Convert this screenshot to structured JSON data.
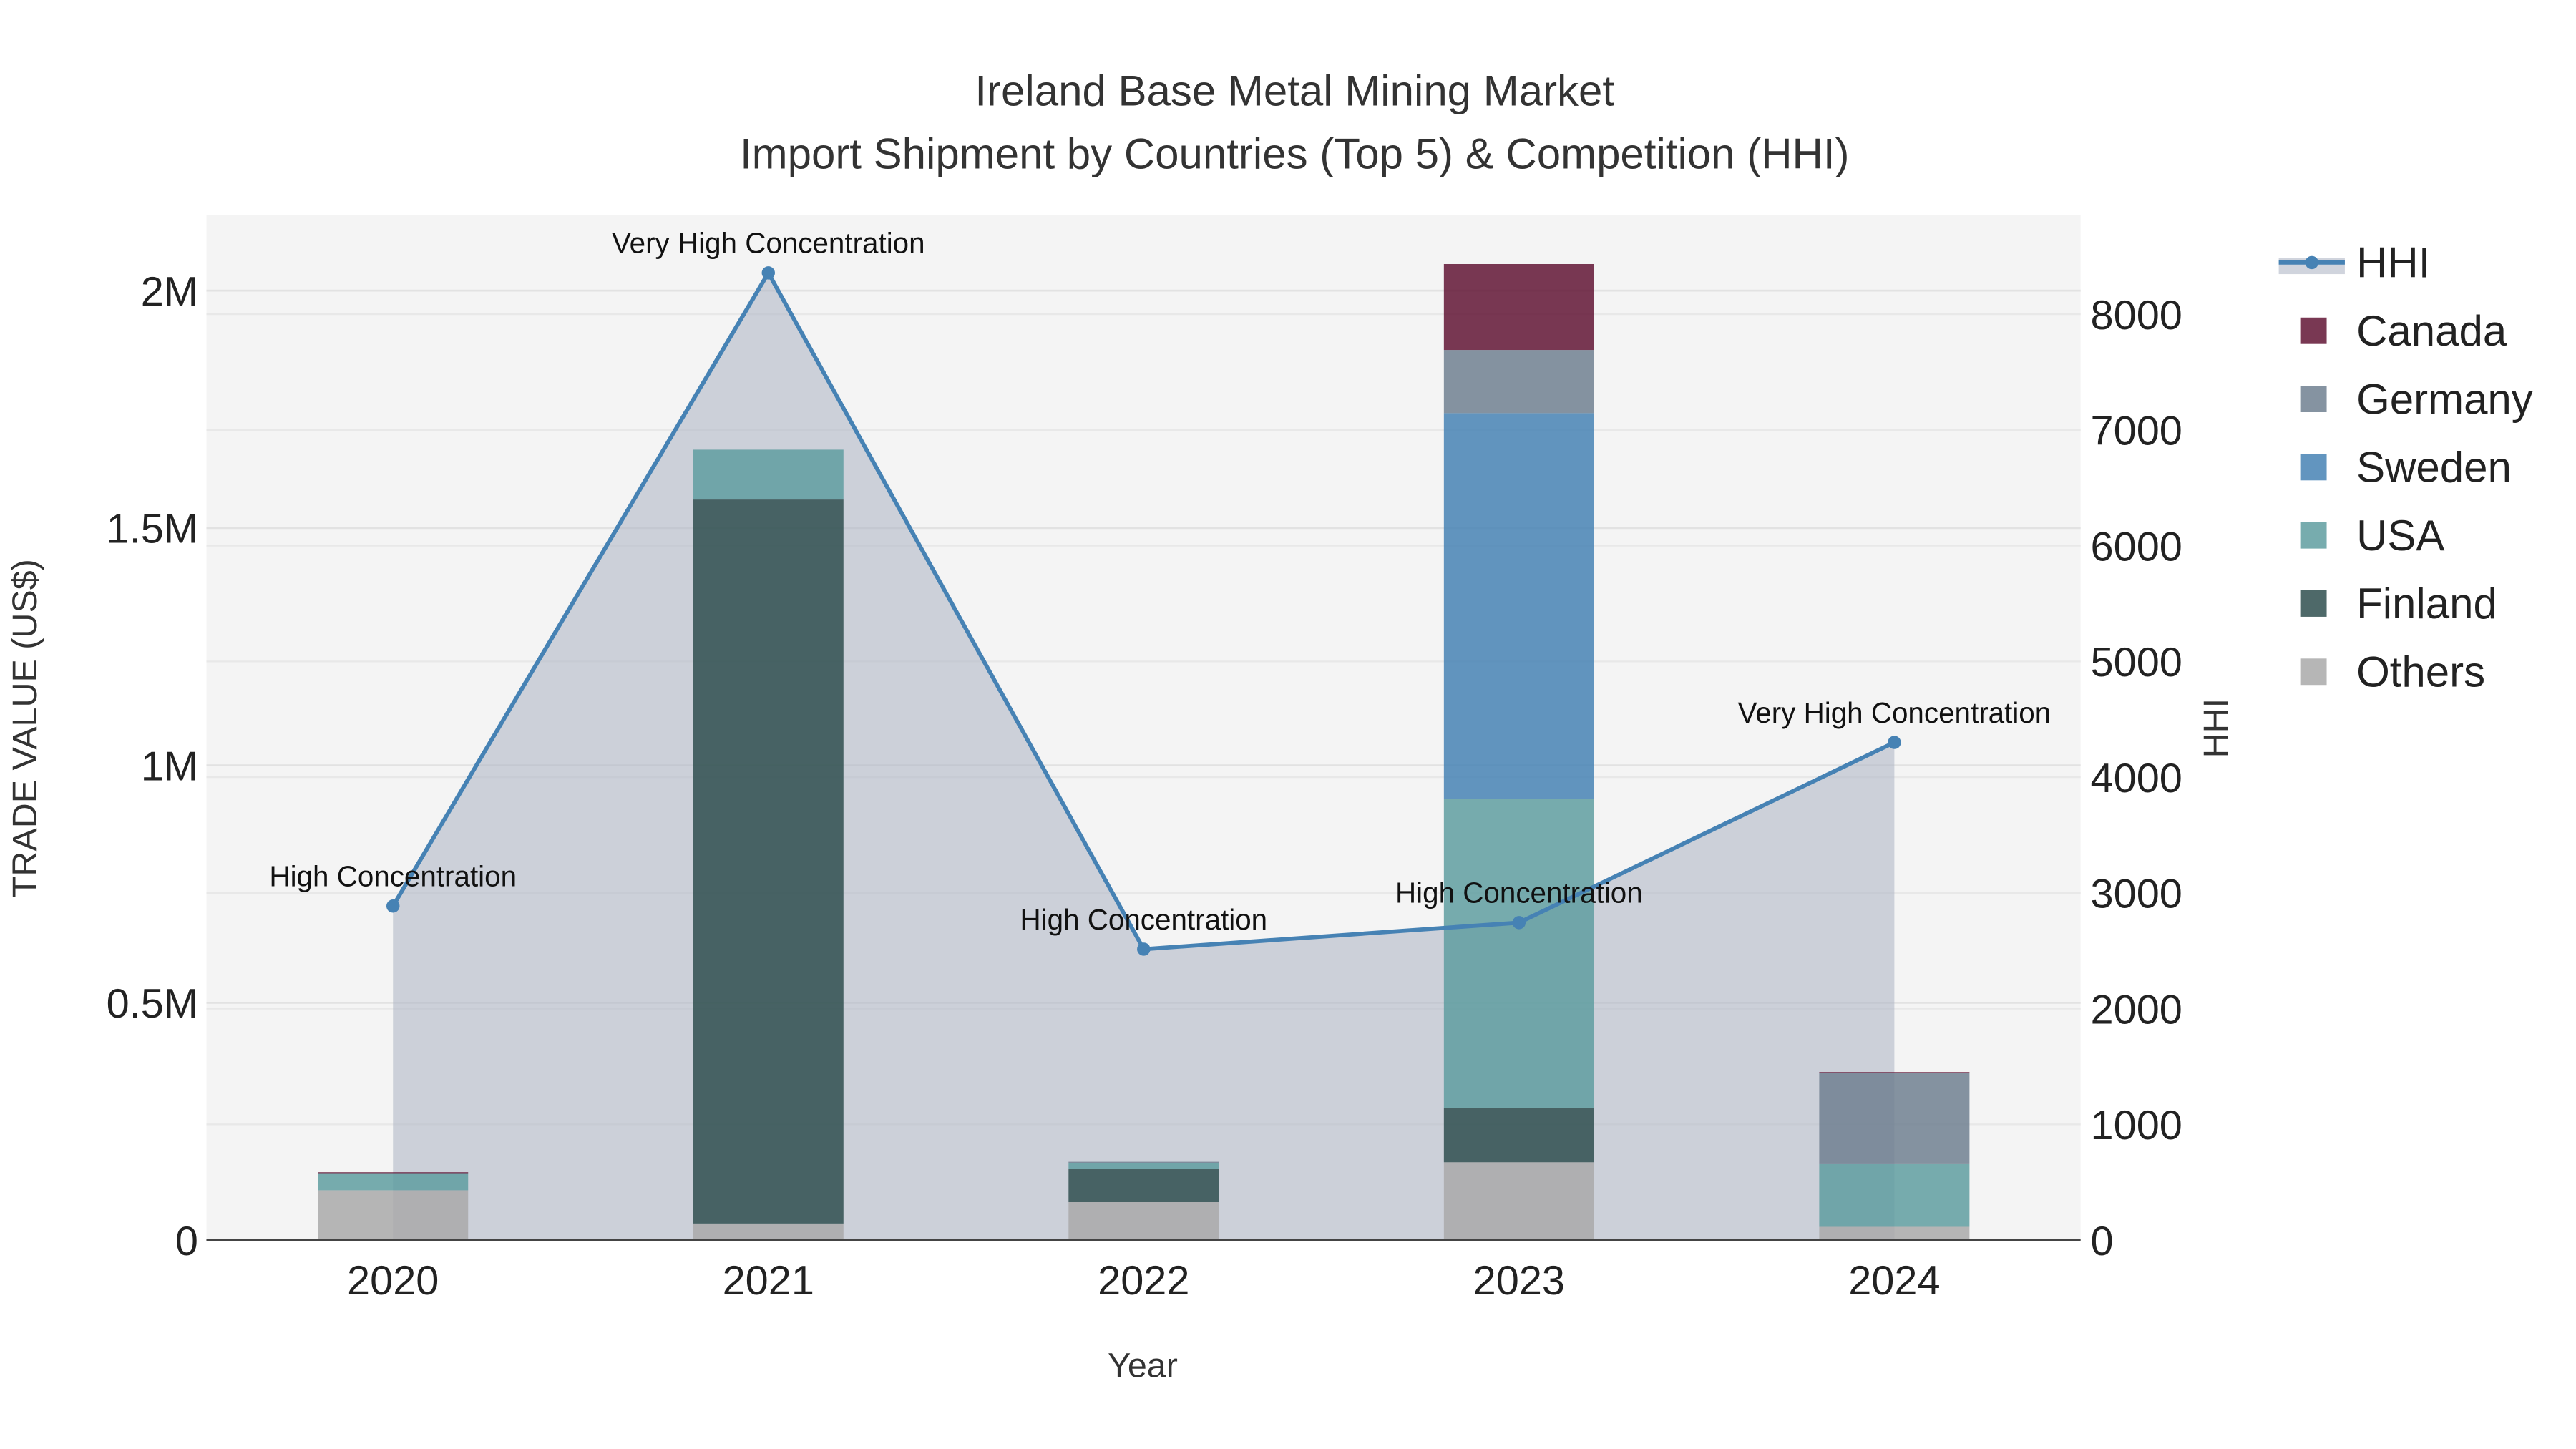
{
  "chart_data": {
    "type": "bar",
    "title": "Ireland Base Metal Mining Market",
    "subtitle": "Import Shipment by Countries (Top 5) & Competition (HHI)",
    "xlabel": "Year",
    "ylabel": "TRADE VALUE (US$)",
    "y2label": "HHI",
    "categories": [
      "2020",
      "2021",
      "2022",
      "2023",
      "2024"
    ],
    "ylim": [
      0,
      2160000
    ],
    "y2lim": [
      0,
      8860
    ],
    "yticks": [
      {
        "v": 0,
        "label": "0"
      },
      {
        "v": 500000,
        "label": "0.5M"
      },
      {
        "v": 1000000,
        "label": "1M"
      },
      {
        "v": 1500000,
        "label": "1.5M"
      },
      {
        "v": 2000000,
        "label": "2M"
      }
    ],
    "y2ticks": [
      0,
      1000,
      2000,
      3000,
      4000,
      5000,
      6000,
      7000,
      8000
    ],
    "stacked": true,
    "series": [
      {
        "name": "Others",
        "color": "#a9a9a9",
        "values": [
          105000,
          35000,
          80000,
          164000,
          28000
        ]
      },
      {
        "name": "Finland",
        "color": "#2f4f4f",
        "values": [
          0,
          1525000,
          70000,
          115000,
          0
        ]
      },
      {
        "name": "USA",
        "color": "#5f9ea0",
        "values": [
          36000,
          105000,
          12000,
          651000,
          132000
        ]
      },
      {
        "name": "Sweden",
        "color": "#4682b4",
        "values": [
          0,
          0,
          0,
          812000,
          0
        ]
      },
      {
        "name": "Germany",
        "color": "#708090",
        "values": [
          0,
          0,
          3000,
          133000,
          192000
        ]
      },
      {
        "name": "Canada",
        "color": "#611535",
        "values": [
          2000,
          0,
          0,
          181000,
          2000
        ]
      }
    ],
    "hhi": {
      "name": "HHI",
      "color": "#4682b4",
      "values": [
        2886,
        8357,
        2514,
        2743,
        4300
      ],
      "annotations": [
        "High Concentration",
        "Very High Concentration",
        "High Concentration",
        "High Concentration",
        "Very High Concentration"
      ]
    },
    "legend": {
      "placement": "right",
      "order": [
        "HHI",
        "Canada",
        "Germany",
        "Sweden",
        "USA",
        "Finland",
        "Others"
      ]
    },
    "grid": true
  }
}
